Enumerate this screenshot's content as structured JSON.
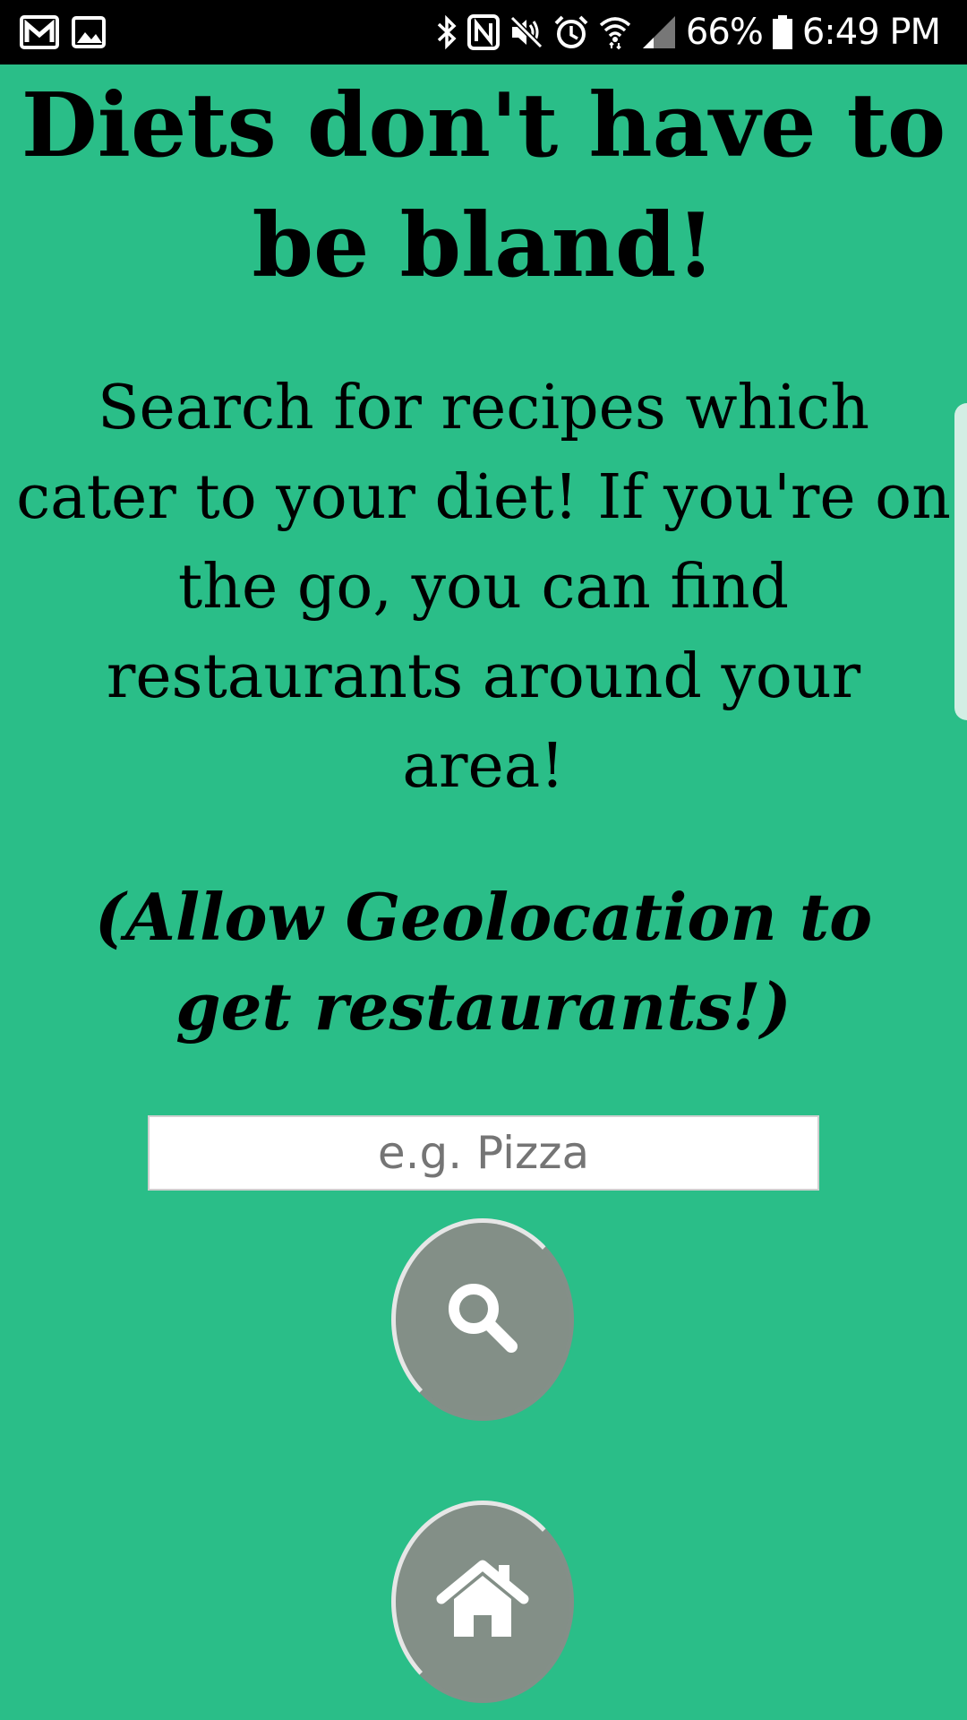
{
  "status_bar": {
    "left_icons": [
      "gmail-icon",
      "gallery-icon"
    ],
    "right_icons": [
      "bluetooth-icon",
      "nfc-icon",
      "mute-icon",
      "alarm-icon",
      "wifi-icon",
      "signal-icon",
      "battery-icon"
    ],
    "battery": "66%",
    "time": "6:49 PM"
  },
  "main": {
    "headline": "Diets don't have to be bland!",
    "description": "Search for recipes which cater to your diet! If you're on the go, you can find restaurants around your area!",
    "geo_note": "(Allow Geolocation to get restaurants!)"
  },
  "search": {
    "value": "",
    "placeholder": "e.g. Pizza"
  },
  "buttons": {
    "search": "search-icon",
    "home": "home-icon"
  },
  "colors": {
    "background": "#2abe88",
    "button": "#838f87",
    "button_ring": "#e6e6e6",
    "status_bar": "#000000"
  }
}
